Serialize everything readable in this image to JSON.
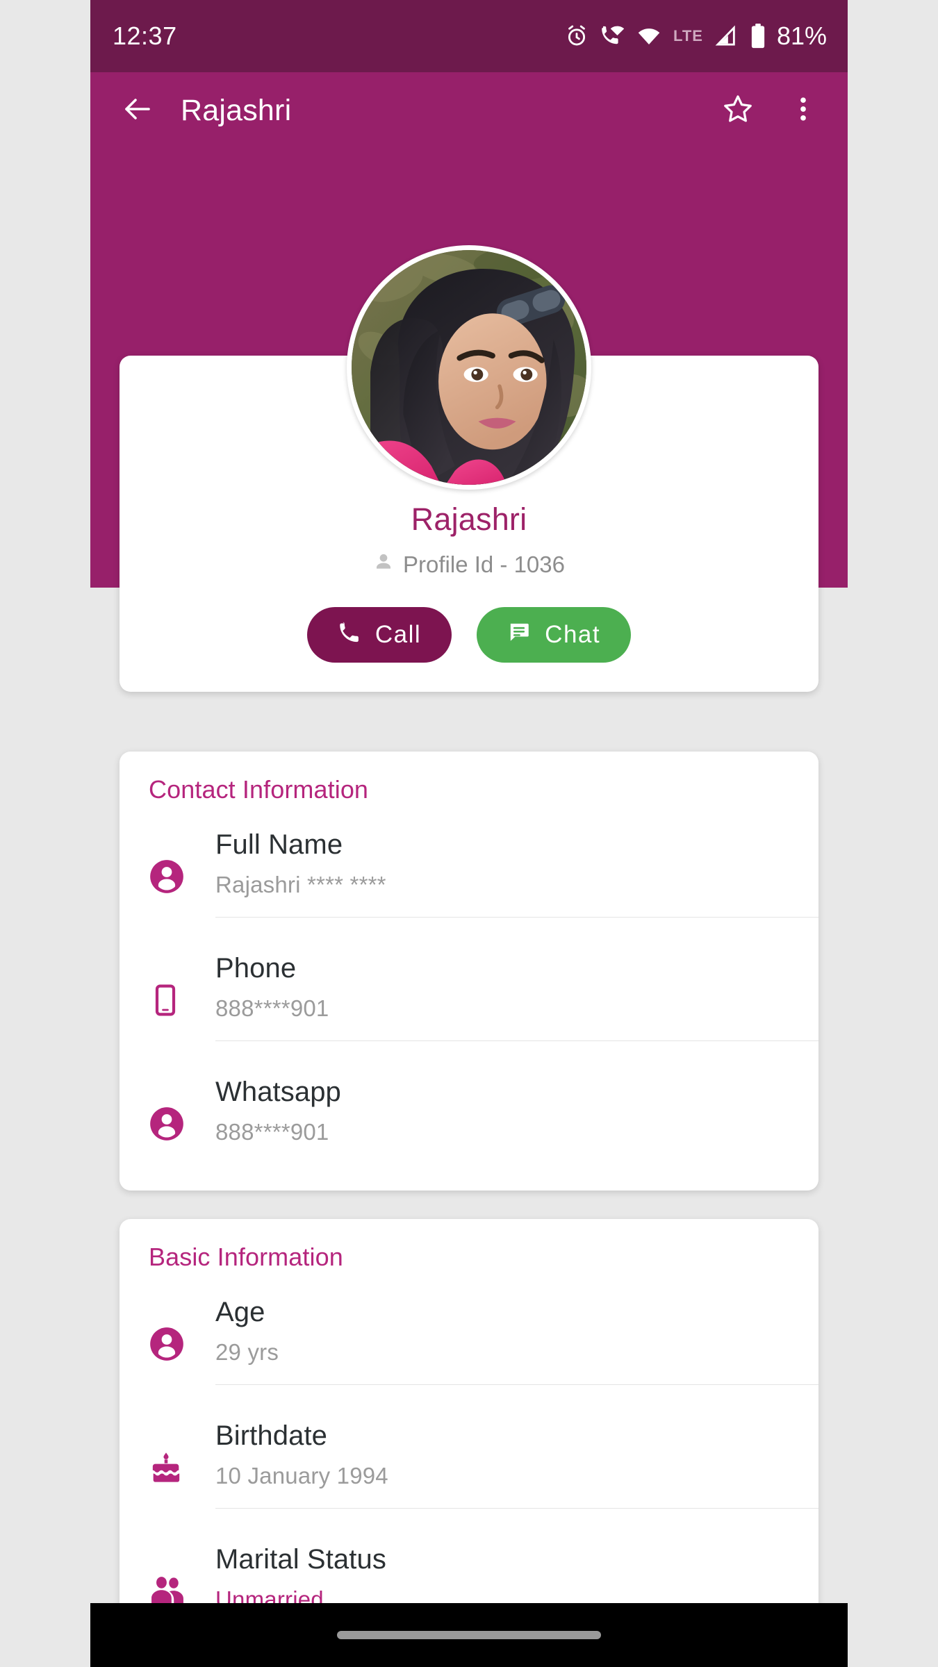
{
  "status_bar": {
    "time": "12:37",
    "network_label": "LTE",
    "battery_percent": "81%",
    "icons": [
      "alarm-icon",
      "vowifi-icon",
      "wifi-icon",
      "signal-icon",
      "battery-icon"
    ]
  },
  "app_bar": {
    "back_icon": "back-arrow-icon",
    "title": "Rajashri",
    "favorite_icon": "star-outline-icon",
    "overflow_icon": "more-vertical-icon"
  },
  "hero": {
    "avatar_alt": "profile-photo",
    "name": "Rajashri",
    "profile_id": "Profile Id - 1036",
    "profile_id_icon": "person-icon",
    "call_label": "Call",
    "call_icon": "phone-icon",
    "chat_label": "Chat",
    "chat_icon": "chat-bubble-icon"
  },
  "contact_information": {
    "title": "Contact Information",
    "rows": [
      {
        "icon": "person-circle-icon",
        "label": "Full Name",
        "value": "Rajashri **** ****"
      },
      {
        "icon": "smartphone-icon",
        "label": "Phone",
        "value": "888****901"
      },
      {
        "icon": "person-circle-icon",
        "label": "Whatsapp",
        "value": "888****901"
      }
    ]
  },
  "basic_information": {
    "title": "Basic Information",
    "rows": [
      {
        "icon": "person-circle-icon",
        "label": "Age",
        "value": "29 yrs"
      },
      {
        "icon": "birthday-cake-icon",
        "label": "Birthdate",
        "value": "10 January 1994"
      },
      {
        "icon": "people-group-icon",
        "label": "Marital Status",
        "value": "Unmarried"
      }
    ]
  },
  "nav_bar": {
    "home_indicator": "home-indicator"
  },
  "colors": {
    "status_bar": "#6d1a4c",
    "app_bar": "#97206a",
    "accent": "#b5257d",
    "call_button": "#7d1450",
    "chat_button": "#4caf50",
    "page_background": "#e8e8e8"
  }
}
